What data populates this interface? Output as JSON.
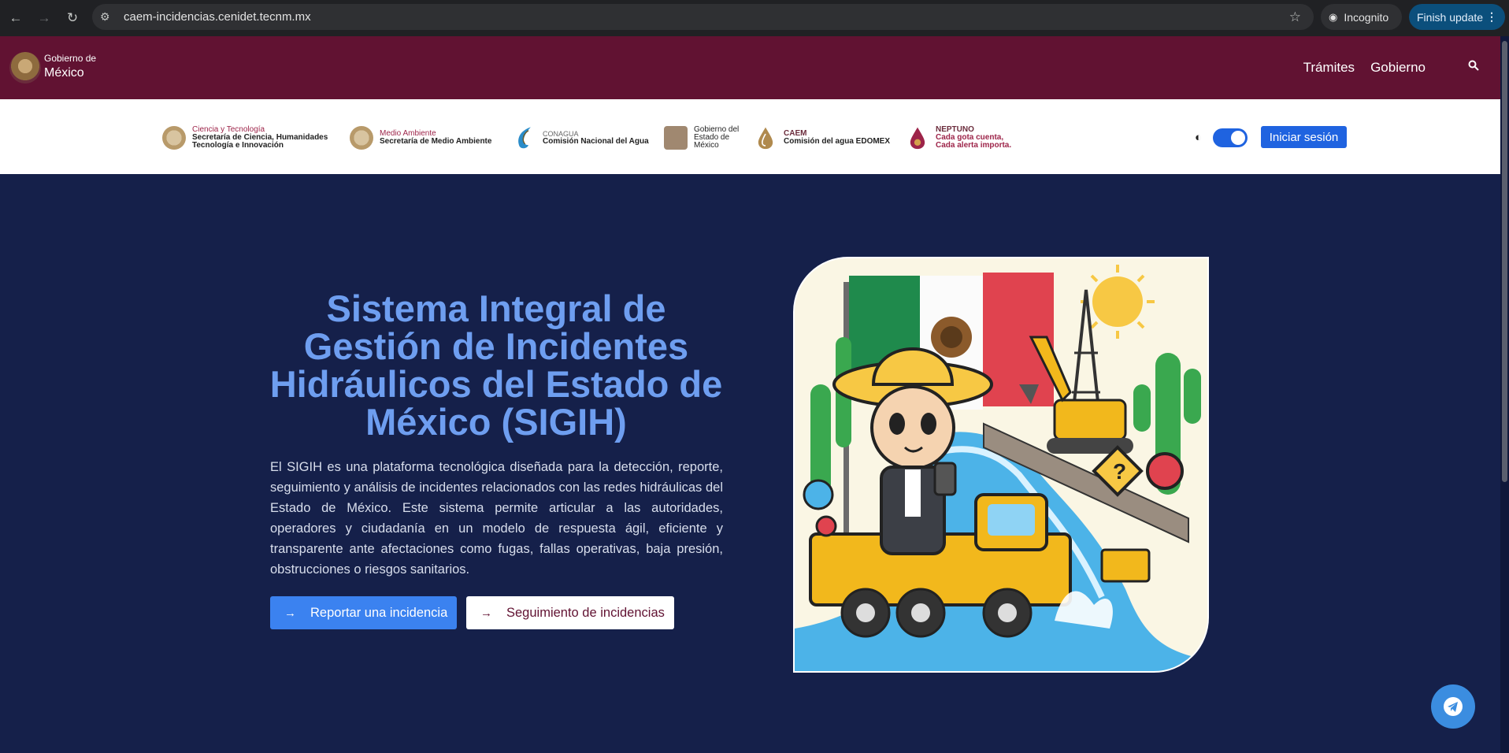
{
  "browser": {
    "url": "caem-incidencias.cenidet.tecnm.mx",
    "incognito_label": "Incognito",
    "update_label": "Finish update"
  },
  "gov_header": {
    "logo_line1": "Gobierno de",
    "logo_line2": "México",
    "links": [
      "Trámites",
      "Gobierno"
    ]
  },
  "partners": [
    {
      "small": "Ciencia y Tecnología",
      "bold1": "Secretaría de Ciencia, Humanidades",
      "bold2": "Tecnología e Innovación"
    },
    {
      "small": "Medio Ambiente",
      "bold1": "Secretaría de Medio Ambiente",
      "bold2": ""
    },
    {
      "small": "CONAGUA",
      "bold1": "Comisión Nacional del Agua",
      "bold2": ""
    },
    {
      "small": "",
      "bold1": "Gobierno del",
      "bold2": "Estado de",
      "bold3": "México"
    },
    {
      "small": "CAEM",
      "bold1": "Comisión del agua EDOMEX",
      "bold2": ""
    },
    {
      "small": "NEPTUNO",
      "bold1": "Cada gota cuenta,",
      "bold2": "Cada alerta importa."
    }
  ],
  "login_label": "Iniciar sesión",
  "hero": {
    "title": "Sistema Integral de Gestión de Incidentes Hidráulicos del Estado de México (SIGIH)",
    "description": "El SIGIH es una plataforma tecnológica diseñada para la detección, reporte, seguimiento y análisis de incidentes relacionados con las redes hidráulicas del Estado de México. Este sistema permite articular a las autoridades, operadores y ciudadanía en un modelo de respuesta ágil, eficiente y transparente ante afectaciones como fugas, fallas operativas, baja presión, obstrucciones o riesgos sanitarios.",
    "primary_button": "Reportar una incidencia",
    "secondary_button": "Seguimiento de incidencias"
  },
  "colors": {
    "gov_red": "#611232",
    "hero_bg": "#15204a",
    "accent_blue": "#3b82f0",
    "title_blue": "#6e9ef0"
  }
}
